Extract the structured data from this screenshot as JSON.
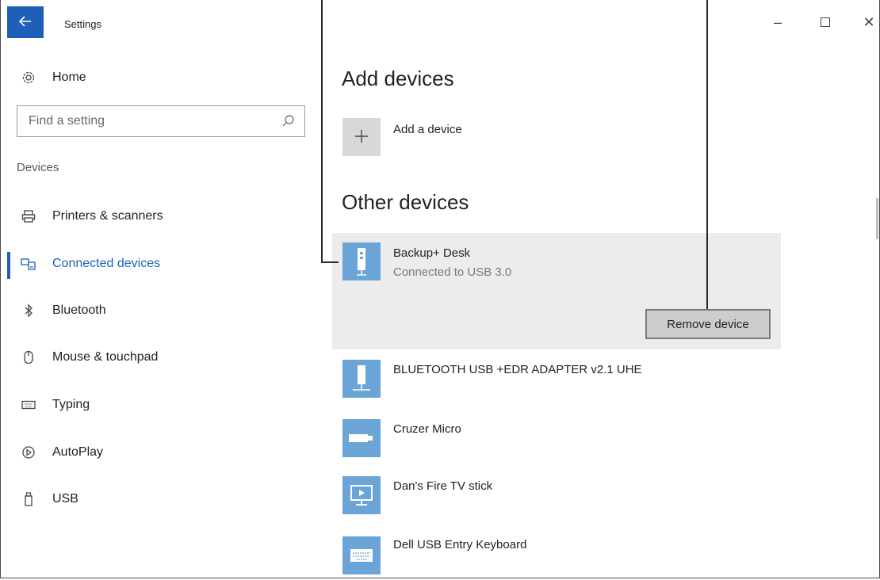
{
  "window": {
    "title": "Settings",
    "controls": {
      "minimize": "–",
      "maximize": "□",
      "close": "✕"
    }
  },
  "sidebar": {
    "home_label": "Home",
    "search": {
      "placeholder": "Find a setting",
      "value": ""
    },
    "section_label": "Devices",
    "items": [
      {
        "label": "Printers & scanners",
        "icon": "printer-icon"
      },
      {
        "label": "Connected devices",
        "icon": "connected-devices-icon",
        "active": true
      },
      {
        "label": "Bluetooth",
        "icon": "bluetooth-icon"
      },
      {
        "label": "Mouse & touchpad",
        "icon": "mouse-icon"
      },
      {
        "label": "Typing",
        "icon": "keyboard-icon"
      },
      {
        "label": "AutoPlay",
        "icon": "autoplay-icon"
      },
      {
        "label": "USB",
        "icon": "usb-icon"
      }
    ]
  },
  "main": {
    "add_devices": {
      "heading": "Add devices",
      "add_label": "Add a device"
    },
    "other_devices": {
      "heading": "Other devices",
      "devices": [
        {
          "name": "Backup+  Desk",
          "status": "Connected to USB 3.0",
          "icon": "drive-icon",
          "selected": true
        },
        {
          "name": "BLUETOOTH USB +EDR ADAPTER v2.1 UHE",
          "icon": "usb-adapter-icon"
        },
        {
          "name": "Cruzer Micro",
          "icon": "flash-drive-icon"
        },
        {
          "name": "Dan's Fire TV stick",
          "icon": "tv-icon"
        },
        {
          "name": "Dell USB Entry Keyboard",
          "icon": "keyboard-icon"
        }
      ],
      "remove_button_label": "Remove device"
    }
  },
  "colors": {
    "accent": "#1e60b8",
    "device_tile": "#6ba5d8",
    "selected_bg": "#ececec",
    "add_tile": "#d8d8d8"
  }
}
